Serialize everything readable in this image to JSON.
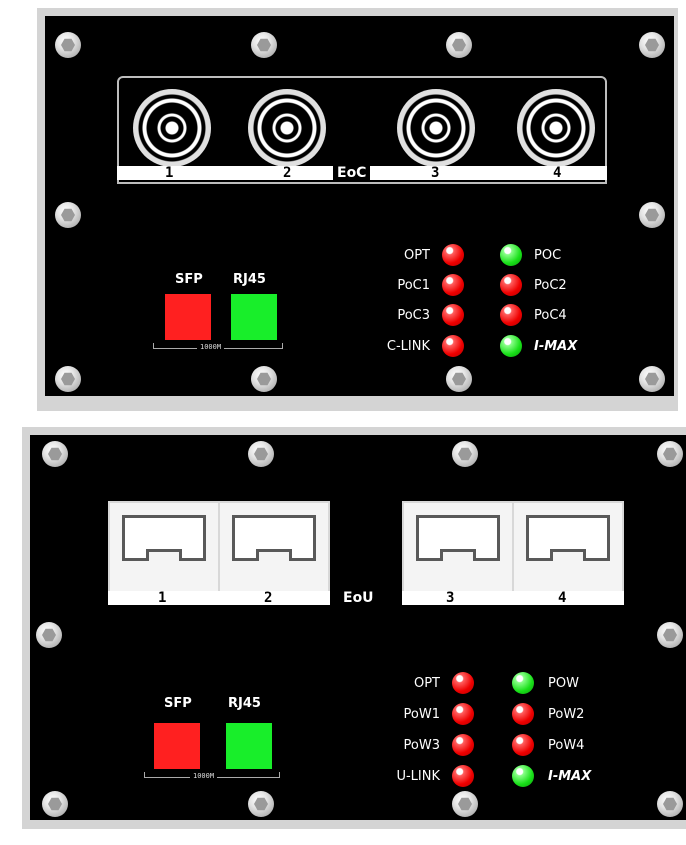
{
  "top_panel": {
    "ports": [
      "1",
      "2",
      "3",
      "4"
    ],
    "port_type_label": "EoC",
    "sfp_label": "SFP",
    "rj45_label": "RJ45",
    "speed_label": "1000M",
    "leds_left": [
      {
        "label": "OPT",
        "color": "#ee0000"
      },
      {
        "label": "PoC1",
        "color": "#ee0000"
      },
      {
        "label": "PoC3",
        "color": "#ee0000"
      },
      {
        "label": "C-LINK",
        "color": "#ee0000"
      }
    ],
    "leds_right": [
      {
        "label": "POC",
        "color": "#19e019"
      },
      {
        "label": "PoC2",
        "color": "#ee0000"
      },
      {
        "label": "PoC4",
        "color": "#ee0000"
      },
      {
        "label": "I-MAX",
        "color": "#19e019"
      }
    ]
  },
  "bottom_panel": {
    "ports": [
      "1",
      "2",
      "3",
      "4"
    ],
    "port_type_label": "EoU",
    "sfp_label": "SFP",
    "rj45_label": "RJ45",
    "speed_label": "1000M",
    "leds_left": [
      {
        "label": "OPT",
        "color": "#ee0000"
      },
      {
        "label": "PoW1",
        "color": "#ee0000"
      },
      {
        "label": "PoW3",
        "color": "#ee0000"
      },
      {
        "label": "U-LINK",
        "color": "#ee0000"
      }
    ],
    "leds_right": [
      {
        "label": "POW",
        "color": "#19e019"
      },
      {
        "label": "PoW2",
        "color": "#ee0000"
      },
      {
        "label": "PoW4",
        "color": "#ee0000"
      },
      {
        "label": "I-MAX",
        "color": "#19e019"
      }
    ]
  },
  "colors": {
    "sfp_square": "#ff2020",
    "rj45_square": "#18ee2a",
    "panel": "#000000",
    "frame": "#d4d4d4"
  }
}
